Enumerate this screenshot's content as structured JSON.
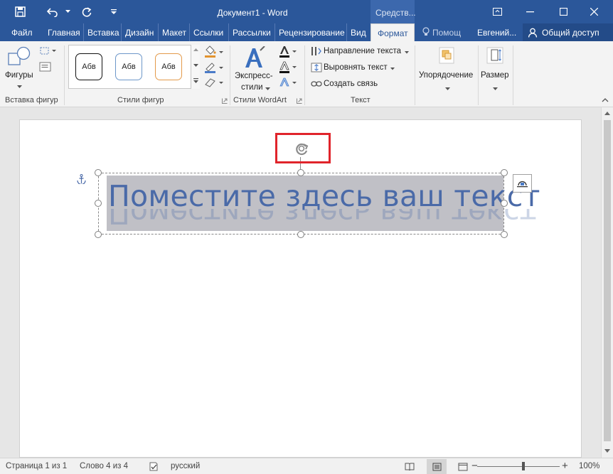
{
  "window": {
    "title": "Документ1 - Word",
    "tools_tab": "Средств...",
    "accent": "#2b579a"
  },
  "qat": {
    "save_icon": "save-icon",
    "undo_icon": "undo-icon",
    "redo_icon": "redo-icon",
    "customize_icon": "customize-icon"
  },
  "tabs": {
    "file": "Файл",
    "home": "Главная",
    "insert": "Вставка",
    "design": "Дизайн",
    "layout": "Макет",
    "references": "Ссылки",
    "mailings": "Рассылки",
    "review": "Рецензирование",
    "view": "Вид",
    "format": "Формат",
    "help": "Помощ",
    "user": "Евгений...",
    "share": "Общий доступ"
  },
  "ribbon": {
    "shapes_label": "Фигуры",
    "insert_shapes_group": "Вставка фигур",
    "style_swatch_1": "Абв",
    "style_swatch_2": "Абв",
    "style_swatch_3": "Абв",
    "shape_styles_group": "Стили фигур",
    "express_label": "Экспресс-",
    "express_label2": "стили",
    "wordart_group": "Стили WordArt",
    "text_direction": "Направление текста",
    "align_text": "Выровнять текст",
    "create_link": "Создать связь",
    "text_group": "Текст",
    "arrange_label": "Упорядочение",
    "size_label": "Размер"
  },
  "document": {
    "wordart_text": "Поместите здесь ваш текст",
    "wordart_color": "#4a6aa8",
    "highlight_color": "#e0242b"
  },
  "status": {
    "page": "Страница 1 из 1",
    "words": "Слово 4 из 4",
    "language": "русский",
    "zoom": "100%"
  }
}
